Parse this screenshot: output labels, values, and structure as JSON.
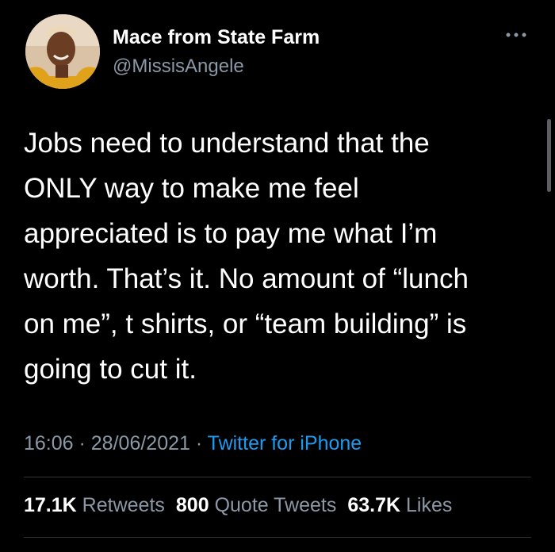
{
  "author": {
    "name": "Mace from State Farm",
    "handle": "@MissisAngele"
  },
  "tweet": {
    "lines": [
      "Jobs need to understand that the",
      "ONLY way to make me feel",
      "appreciated is to pay me what I’m",
      "worth. That’s it. No amount of “lunch",
      "on me”, t shirts, or “team building” is",
      "going to cut it."
    ]
  },
  "meta": {
    "time": "16:06",
    "separator": " · ",
    "date": "28/06/2021",
    "source": "Twitter for iPhone"
  },
  "stats": {
    "retweets_count": "17.1K",
    "retweets_label": "Retweets",
    "quote_count": "800",
    "quote_label": "Quote Tweets",
    "likes_count": "63.7K",
    "likes_label": "Likes"
  },
  "icons": {
    "more": "more-horizontal-icon",
    "avatar": "profile-avatar"
  },
  "colors": {
    "background": "#000000",
    "text": "#ffffff",
    "secondary": "#8b98a5",
    "link": "#1d9bf0",
    "divider": "#2f3336"
  }
}
